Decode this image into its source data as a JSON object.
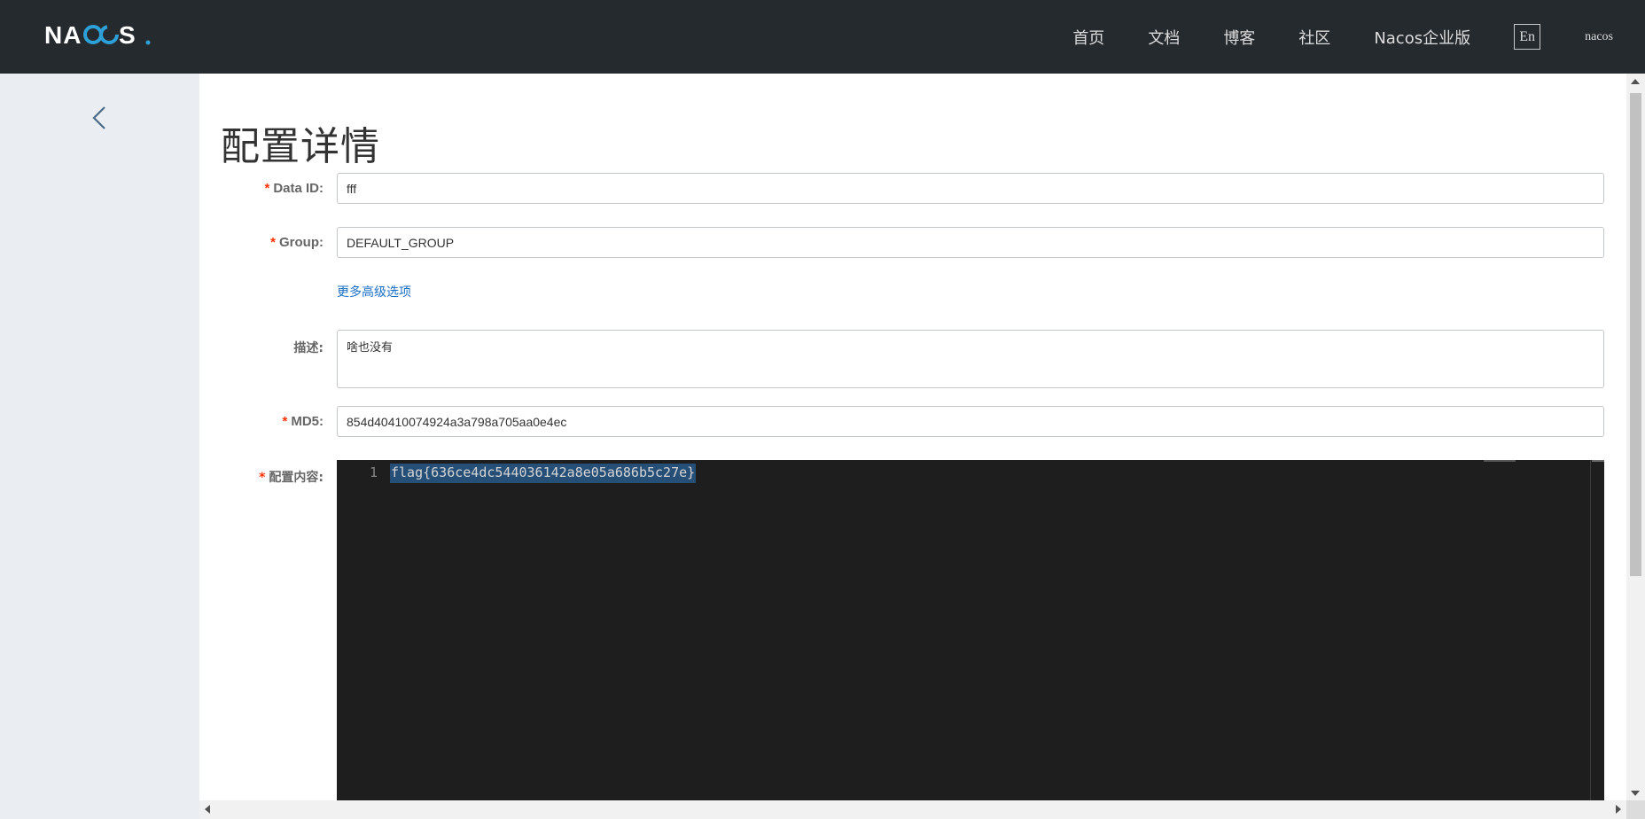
{
  "header": {
    "logo_text": "NACOS.",
    "nav": [
      {
        "label": "首页"
      },
      {
        "label": "文档"
      },
      {
        "label": "博客"
      },
      {
        "label": "社区"
      },
      {
        "label": "Nacos企业版"
      }
    ],
    "lang_button": "En",
    "username": "nacos",
    "colors": {
      "background": "#252a2f",
      "logo_accent": "#2ea0d8"
    }
  },
  "sidebar": {
    "back_icon": "chevron-left-icon"
  },
  "main": {
    "title": "配置详情",
    "fields": {
      "data_id": {
        "label": "Data ID:",
        "value": "fff",
        "required": true
      },
      "group": {
        "label": "Group:",
        "value": "DEFAULT_GROUP",
        "required": true
      },
      "advanced_link": "更多高级选项",
      "description": {
        "label": "描述:",
        "value": "啥也没有"
      },
      "md5": {
        "label": "MD5:",
        "value": "854d40410074924a3a798a705aa0e4ec",
        "required": true
      },
      "content": {
        "label": "配置内容:",
        "required": true,
        "lines": [
          {
            "number": "1",
            "text": "flag{636ce4dc544036142a8e05a686b5c27e}"
          }
        ]
      }
    },
    "required_marker": "*",
    "colors": {
      "required": "#ff3000",
      "link": "#1a6fc4",
      "editor_bg": "#1e1e1e",
      "selection": "#264f78"
    }
  }
}
